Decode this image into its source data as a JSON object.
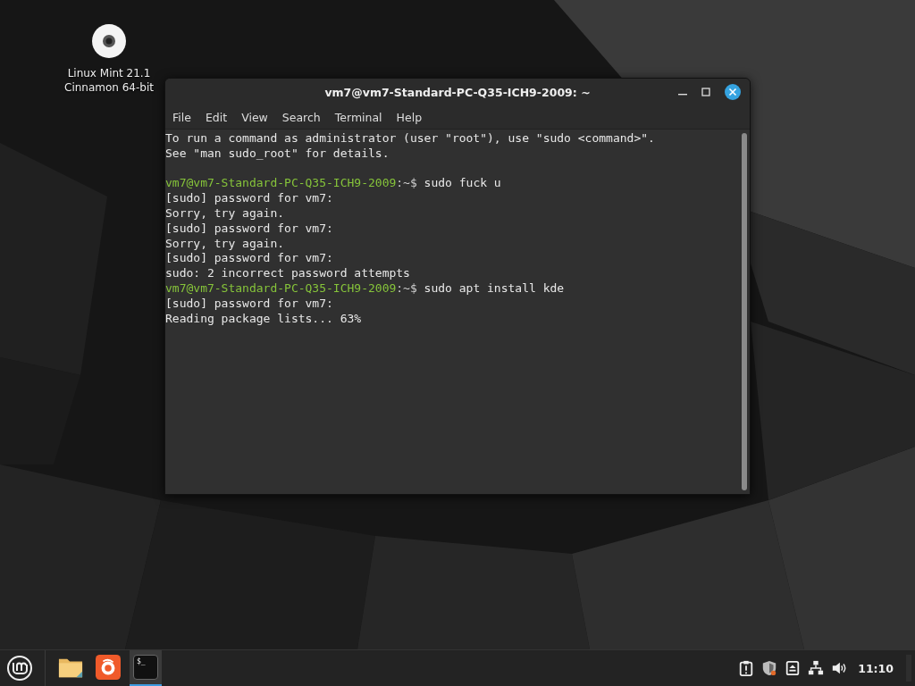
{
  "desktop": {
    "icons": [
      {
        "label": "Linux Mint 21.1\nCinnamon 64-bit"
      }
    ]
  },
  "window": {
    "title": "vm7@vm7-Standard-PC-Q35-ICH9-2009: ~",
    "menu": [
      "File",
      "Edit",
      "View",
      "Search",
      "Terminal",
      "Help"
    ],
    "lines": [
      {
        "kind": "text",
        "text": "To run a command as administrator (user \"root\"), use \"sudo <command>\"."
      },
      {
        "kind": "text",
        "text": "See \"man sudo_root\" for details."
      },
      {
        "kind": "blank"
      },
      {
        "kind": "prompt",
        "prompt": "vm7@vm7-Standard-PC-Q35-ICH9-2009",
        "suffix": ":~$",
        "command": "sudo fuck u"
      },
      {
        "kind": "text",
        "text": "[sudo] password for vm7:"
      },
      {
        "kind": "text",
        "text": "Sorry, try again."
      },
      {
        "kind": "text",
        "text": "[sudo] password for vm7:"
      },
      {
        "kind": "text",
        "text": "Sorry, try again."
      },
      {
        "kind": "text",
        "text": "[sudo] password for vm7:"
      },
      {
        "kind": "text",
        "text": "sudo: 2 incorrect password attempts"
      },
      {
        "kind": "prompt",
        "prompt": "vm7@vm7-Standard-PC-Q35-ICH9-2009",
        "suffix": ":~$",
        "command": "sudo apt install kde"
      },
      {
        "kind": "text",
        "text": "[sudo] password for vm7:"
      },
      {
        "kind": "text",
        "text": "Reading package lists... 63%"
      }
    ]
  },
  "taskbar": {
    "launchers": [
      {
        "kind": "files",
        "selected": false
      },
      {
        "kind": "browser",
        "selected": false
      },
      {
        "kind": "terminal",
        "glyph": "$_",
        "selected": true
      }
    ],
    "tray": [
      {
        "kind": "notes"
      },
      {
        "kind": "shield"
      },
      {
        "kind": "eject"
      },
      {
        "kind": "network"
      },
      {
        "kind": "volume"
      }
    ],
    "clock": "11:10"
  }
}
